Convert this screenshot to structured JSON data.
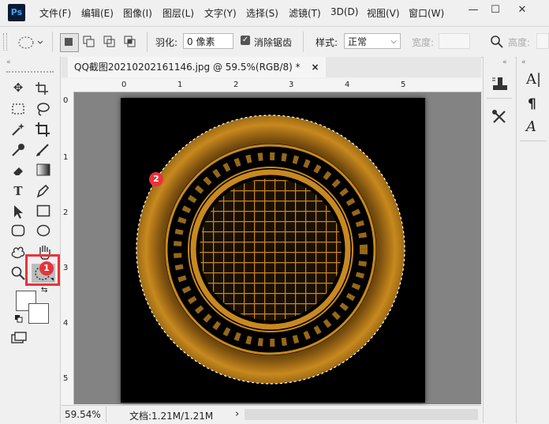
{
  "app": {
    "logo": "Ps"
  },
  "menu": [
    "文件(F)",
    "编辑(E)",
    "图像(I)",
    "图层(L)",
    "文字(Y)",
    "选择(S)",
    "滤镜(T)",
    "3D(D)",
    "视图(V)",
    "窗口(W)"
  ],
  "window_controls": {
    "minimize": "—",
    "maximize": "☐",
    "close": "✕"
  },
  "options": {
    "feather_label": "羽化:",
    "feather_value": "0 像素",
    "antialias_label": "消除锯齿",
    "antialias_checked": true,
    "style_label": "样式:",
    "style_value": "正常",
    "width_label": "宽度:",
    "height_label": "高度:"
  },
  "document": {
    "tab_title": "QQ截图20210202161146.jpg @ 59.5%(RGB/8) *",
    "close": "×",
    "ruler_h": [
      "0",
      "1",
      "2",
      "3",
      "4",
      "5"
    ],
    "ruler_v": [
      "0",
      "1",
      "2",
      "3",
      "4",
      "5"
    ]
  },
  "status": {
    "zoom": "59.54%",
    "doc_info": "文档:1.21M/1.21M",
    "arrow": "›"
  },
  "annotations": {
    "badge1": "1",
    "badge2": "2"
  },
  "colors": {
    "badge": "#e8333a",
    "gold": "#c8891e",
    "canvas": "#000000"
  },
  "icons": [
    "move-icon",
    "artboard-icon",
    "marquee-icon",
    "lasso-icon",
    "magic-wand-icon",
    "crop-icon",
    "eyedropper-icon",
    "brush-icon",
    "eraser-icon",
    "gradient-icon",
    "type-icon",
    "pen-icon",
    "path-select-icon",
    "rectangle-icon",
    "rounded-rect-icon",
    "ellipse-icon",
    "shape-icon",
    "hand-icon",
    "zoom-icon",
    "ellipse-marquee-icon",
    "swap-icon",
    "default-colors-icon",
    "screen-mode-icon"
  ]
}
